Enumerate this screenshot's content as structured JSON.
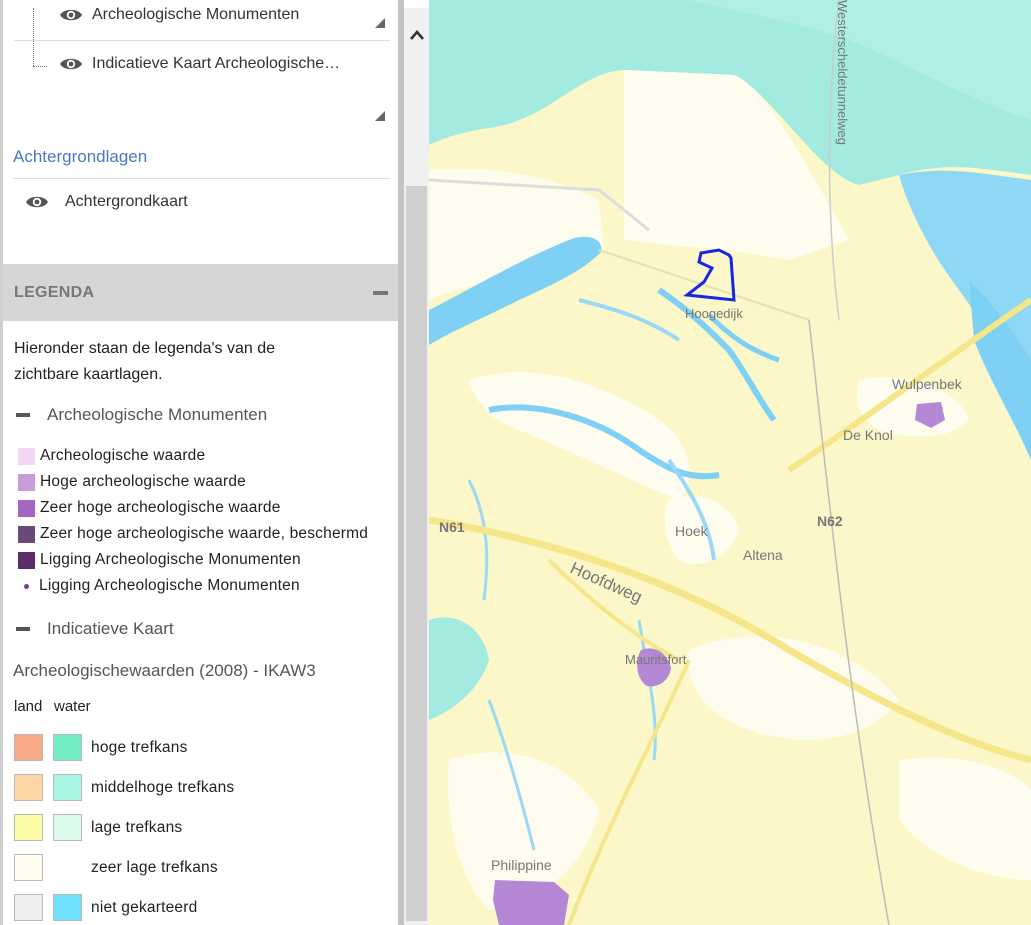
{
  "layers": {
    "items": [
      {
        "label": "Archeologische Monumenten",
        "icon": "eye-icon"
      },
      {
        "label": "Indicatieve Kaart Archeologische…",
        "icon": "eye-icon"
      }
    ],
    "background_section_title": "Achtergrondlagen",
    "background_items": [
      {
        "label": "Achtergrondkaart",
        "icon": "eye-icon"
      }
    ]
  },
  "legend": {
    "title": "LEGENDA",
    "intro": "Hieronder staan de legenda's van de zichtbare kaartlagen.",
    "groups": [
      {
        "title": "Archeologische Monumenten",
        "items": [
          {
            "label": "Archeologische waarde",
            "color": "#f2d6f2",
            "shape": "square"
          },
          {
            "label": "Hoge archeologische waarde",
            "color": "#c79ad8",
            "shape": "square"
          },
          {
            "label": "Zeer hoge archeologische waarde",
            "color": "#a466c0",
            "shape": "square"
          },
          {
            "label": "Zeer hoge archeologische waarde, beschermd",
            "color": "#6a4a7a",
            "shape": "square"
          },
          {
            "label": "Ligging Archeologische Monumenten",
            "color": "#5a2f68",
            "shape": "square"
          },
          {
            "label": "Ligging Archeologische Monumenten",
            "color": "#7a3a9a",
            "shape": "dot"
          }
        ]
      },
      {
        "title": "Indicatieve Kaart",
        "subtitle": "Archeologischewaarden (2008) - IKAW3",
        "column_land": "land",
        "column_water": "water",
        "items": [
          {
            "label": "hoge trefkans",
            "land": "#f7a988",
            "water": "#72ecc0"
          },
          {
            "label": "middelhoge trefkans",
            "land": "#fdd5a3",
            "water": "#a8f5e2"
          },
          {
            "label": "lage trefkans",
            "land": "#fdfca6",
            "water": "#dbfaea"
          },
          {
            "label": "zeer lage trefkans",
            "land": "#fefdf0",
            "water": null
          },
          {
            "label": "niet gekarteerd",
            "land": "#ededed",
            "water": "#6fe0fb"
          }
        ]
      }
    ]
  },
  "map": {
    "labels": {
      "hoogedijk": "Hoogedijk",
      "wulpenbek": "Wulpenbek",
      "de_knol": "De Knol",
      "n61": "N61",
      "n62": "N62",
      "hoek": "Hoek",
      "altena": "Altena",
      "hoofdweg": "Hoofdweg",
      "mauritsfort": "Mauritsfort",
      "philippine": "Philippine",
      "westerscheldetunnel": "Westerscheldetunnelweg"
    },
    "colors": {
      "water": "#a3ebe0",
      "land_low": "#fbf7c9",
      "land_very_low": "#fefdf0",
      "channel": "#7fd0f5",
      "monument": "#b488d4",
      "selection": "#1428e6"
    }
  }
}
